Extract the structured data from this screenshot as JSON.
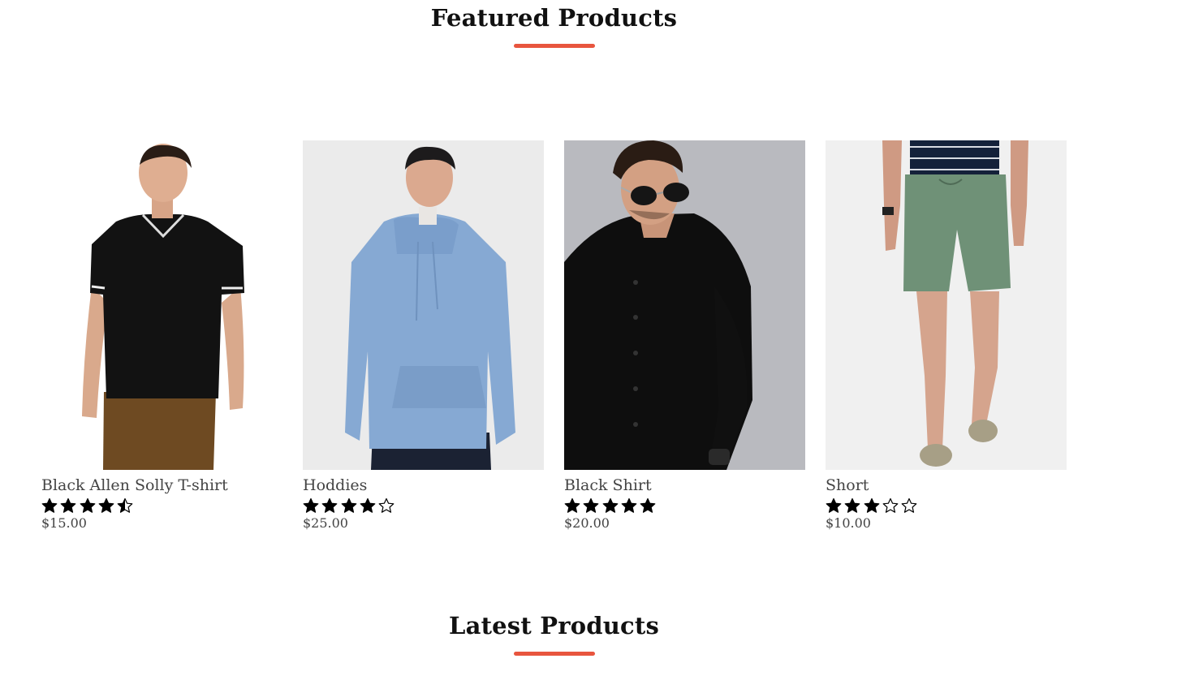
{
  "featured": {
    "title": "Featured Products"
  },
  "latest": {
    "title": "Latest Products"
  },
  "accent_color": "#e8553e",
  "products": [
    {
      "name": "Black Allen Solly T-shirt",
      "rating": 4.5,
      "price": "$15.00",
      "image": "black-polo-tshirt-photo"
    },
    {
      "name": "Hoddies",
      "rating": 4,
      "price": "$25.00",
      "image": "blue-hoodie-photo"
    },
    {
      "name": "Black Shirt",
      "rating": 5,
      "price": "$20.00",
      "image": "black-shirt-sunglasses-photo"
    },
    {
      "name": "Short",
      "rating": 3,
      "price": "$10.00",
      "image": "green-shorts-photo"
    }
  ]
}
